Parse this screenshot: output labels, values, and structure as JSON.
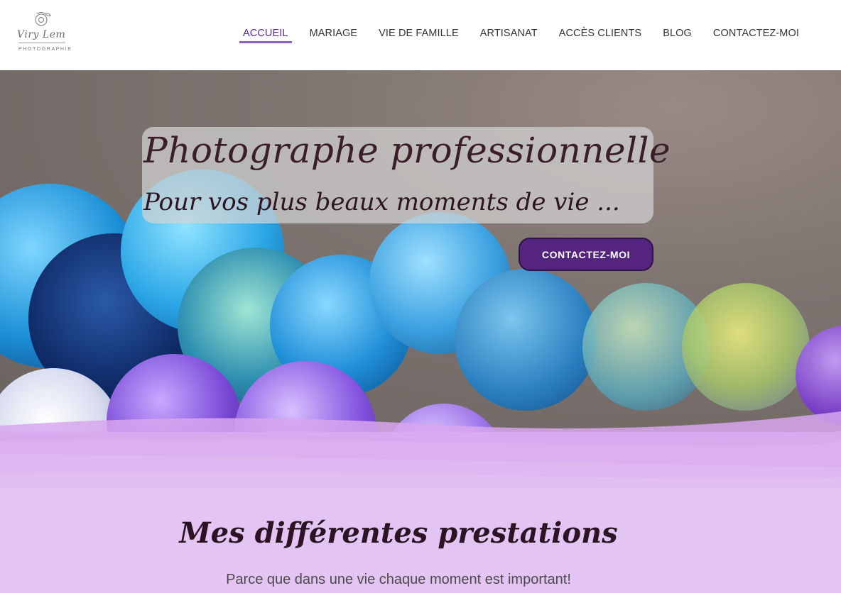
{
  "logo": {
    "script_text": "Viry Lem",
    "sub_text": "PHOTOGRAPHIE"
  },
  "nav": {
    "items": [
      {
        "label": "ACCUEIL",
        "active": true
      },
      {
        "label": "MARIAGE",
        "active": false
      },
      {
        "label": "VIE DE FAMILLE",
        "active": false
      },
      {
        "label": "ARTISANAT",
        "active": false
      },
      {
        "label": "ACCÈS CLIENTS",
        "active": false
      },
      {
        "label": "BLOG",
        "active": false
      },
      {
        "label": "CONTACTEZ-MOI",
        "active": false
      }
    ]
  },
  "hero": {
    "title": "Photographe professionnelle",
    "subtitle": "Pour vos plus beaux moments de vie ...",
    "cta_label": "CONTACTEZ-MOI"
  },
  "section": {
    "title": "Mes différentes prestations",
    "subtitle": "Parce que dans une vie chaque moment est important!"
  },
  "colors": {
    "accent": "#55247f",
    "nav_underline": "#8a63c4",
    "section_bg": "#e4c4f2"
  }
}
